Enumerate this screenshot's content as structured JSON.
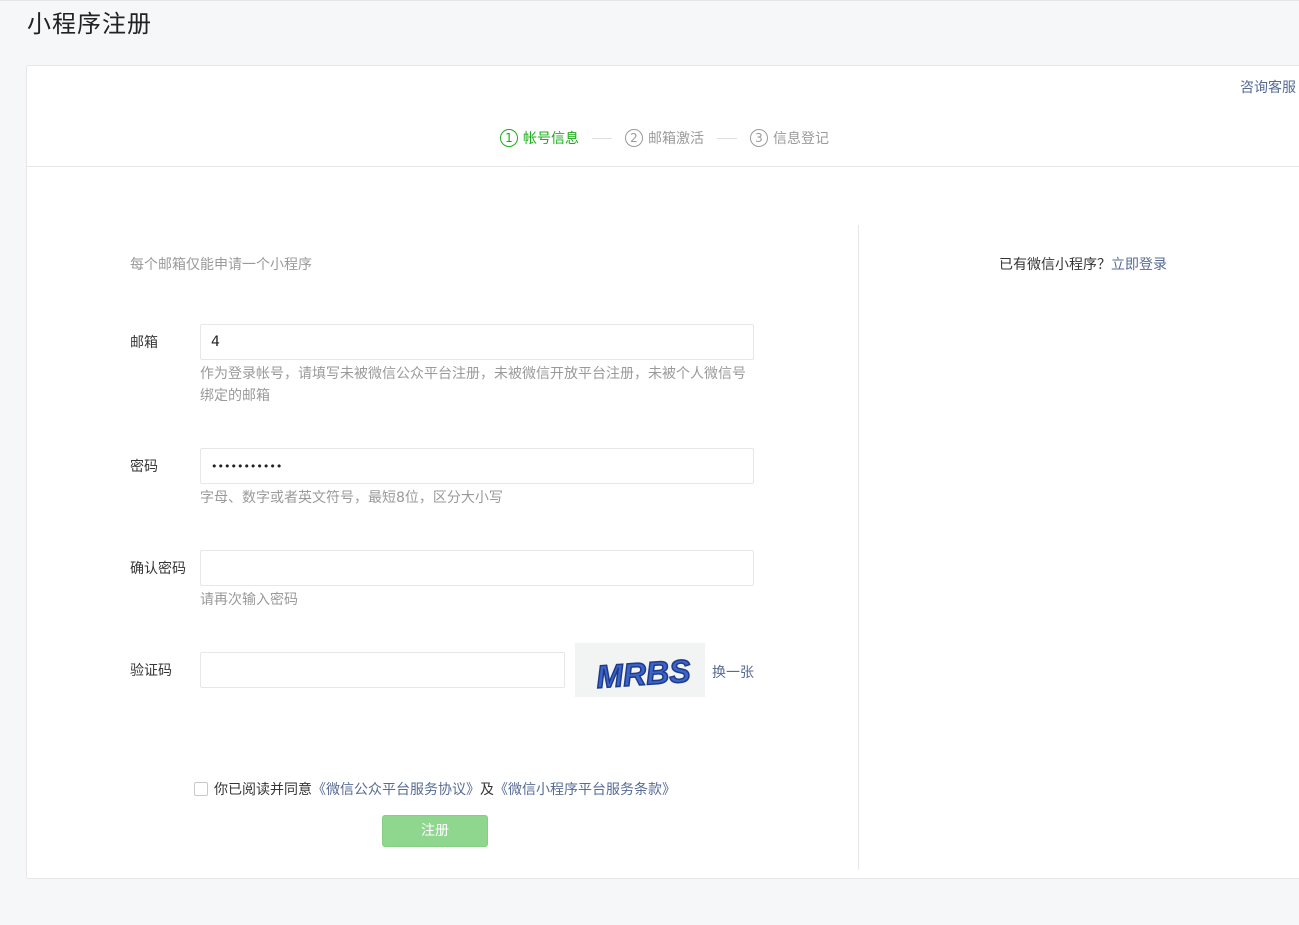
{
  "page": {
    "title": "小程序注册"
  },
  "header": {
    "consult_link": "咨询客服"
  },
  "steps": [
    {
      "number": "1",
      "label": "帐号信息",
      "state": "active"
    },
    {
      "number": "2",
      "label": "邮箱激活",
      "state": "inactive"
    },
    {
      "number": "3",
      "label": "信息登记",
      "state": "inactive"
    }
  ],
  "form": {
    "notice": "每个邮箱仅能申请一个小程序",
    "email": {
      "label": "邮箱",
      "value": "4",
      "hint": "作为登录帐号，请填写未被微信公众平台注册，未被微信开放平台注册，未被个人微信号绑定的邮箱"
    },
    "password": {
      "label": "密码",
      "value": "•••••••••••",
      "hint": "字母、数字或者英文符号，最短8位，区分大小写"
    },
    "confirm_password": {
      "label": "确认密码",
      "value": "",
      "hint": "请再次输入密码"
    },
    "captcha": {
      "label": "验证码",
      "value": "",
      "image_text": "MRBS",
      "refresh_label": "换一张"
    },
    "agreement": {
      "checked": false,
      "prefix": "你已阅读并同意",
      "link1": "《微信公众平台服务协议》",
      "conjunction": "及",
      "link2": "《微信小程序平台服务条款》"
    },
    "submit_label": "注册"
  },
  "side": {
    "question": "已有微信小程序？",
    "login_link": "立即登录"
  },
  "colors": {
    "accent_green": "#1aad19",
    "link_blue": "#576b95",
    "disabled_button": "#8fd78f",
    "captcha_text": "#2b4fa8"
  }
}
